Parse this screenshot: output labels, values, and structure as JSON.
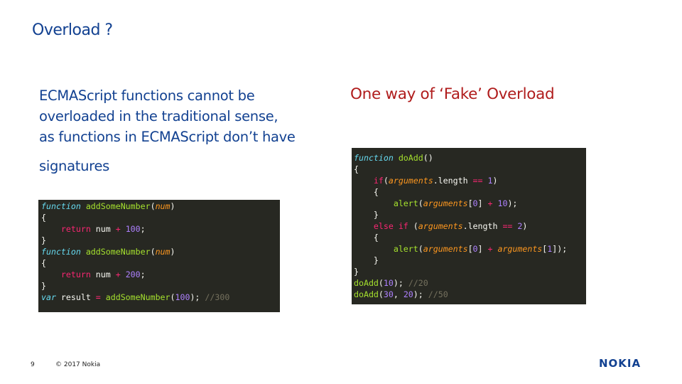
{
  "slide": {
    "title": "Overload ?",
    "left_text": {
      "line1": "ECMAScript functions cannot be",
      "line2": "overloaded in the traditional sense,",
      "line3": "as functions in ECMAScript don’t have",
      "line4": "signatures"
    },
    "right_heading": "One way of ‘Fake’ Overload"
  },
  "code_left": {
    "l1": {
      "kw": "function",
      "name": "addSomeNumber",
      "open": "(",
      "param": "num",
      "close": ")"
    },
    "l2": "{",
    "l3": {
      "indent": "    ",
      "kw": "return",
      "a": " num ",
      "op": "+",
      "sp": " ",
      "num": "100",
      "end": ";"
    },
    "l4": "}",
    "l5": {
      "kw": "function",
      "name": "addSomeNumber",
      "open": "(",
      "param": "num",
      "close": ")"
    },
    "l6": "{",
    "l7": {
      "indent": "    ",
      "kw": "return",
      "a": " num ",
      "op": "+",
      "sp": " ",
      "num": "200",
      "end": ";"
    },
    "l8": "}",
    "l9": {
      "kw": "var",
      "a": " result ",
      "op": "=",
      "sp": " ",
      "call": "addSomeNumber",
      "open": "(",
      "num": "100",
      "close": ");",
      "sp2": " ",
      "comment": "//300"
    }
  },
  "code_right": {
    "l1": {
      "kw": "function",
      "sp": " ",
      "name": "doAdd",
      "rest": "()"
    },
    "l2": "{",
    "l3": {
      "indent": "    ",
      "kw": "if",
      "open": "(",
      "args": "arguments",
      "prop": ".length ",
      "op": "==",
      "sp": " ",
      "num": "1",
      "close": ")"
    },
    "l4": "    {",
    "l5": {
      "indent": "        ",
      "call": "alert",
      "open": "(",
      "args": "arguments",
      "b1": "[",
      "i": "0",
      "b2": "] ",
      "op": "+",
      "sp": " ",
      "num": "10",
      "close": ");"
    },
    "l6": "    }",
    "l7": {
      "indent": "    ",
      "kw": "else if",
      "open": " (",
      "args": "arguments",
      "prop": ".length ",
      "op": "==",
      "sp": " ",
      "num": "2",
      "close": ")"
    },
    "l8": "    {",
    "l9": {
      "indent": "        ",
      "call": "alert",
      "open": "(",
      "args": "arguments",
      "b1": "[",
      "i": "0",
      "b2": "] ",
      "op": "+",
      "sp": " ",
      "args2": "arguments",
      "b3": "[",
      "i2": "1",
      "close": "]);"
    },
    "l10": "    }",
    "l11": "}",
    "l12": {
      "call": "doAdd",
      "open": "(",
      "num": "10",
      "close": ");",
      "sp": " ",
      "comment": "//20"
    },
    "l13": {
      "call": "doAdd",
      "open": "(",
      "num1": "30",
      "comma": ", ",
      "num2": "20",
      "close": ");",
      "sp": " ",
      "comment": "//50"
    }
  },
  "footer": {
    "page_number": "9",
    "copyright": "© 2017 Nokia",
    "logo": "NOKIA"
  },
  "colors": {
    "title_blue": "#124191",
    "heading_red": "#b01c1c",
    "code_background": "#272822"
  }
}
